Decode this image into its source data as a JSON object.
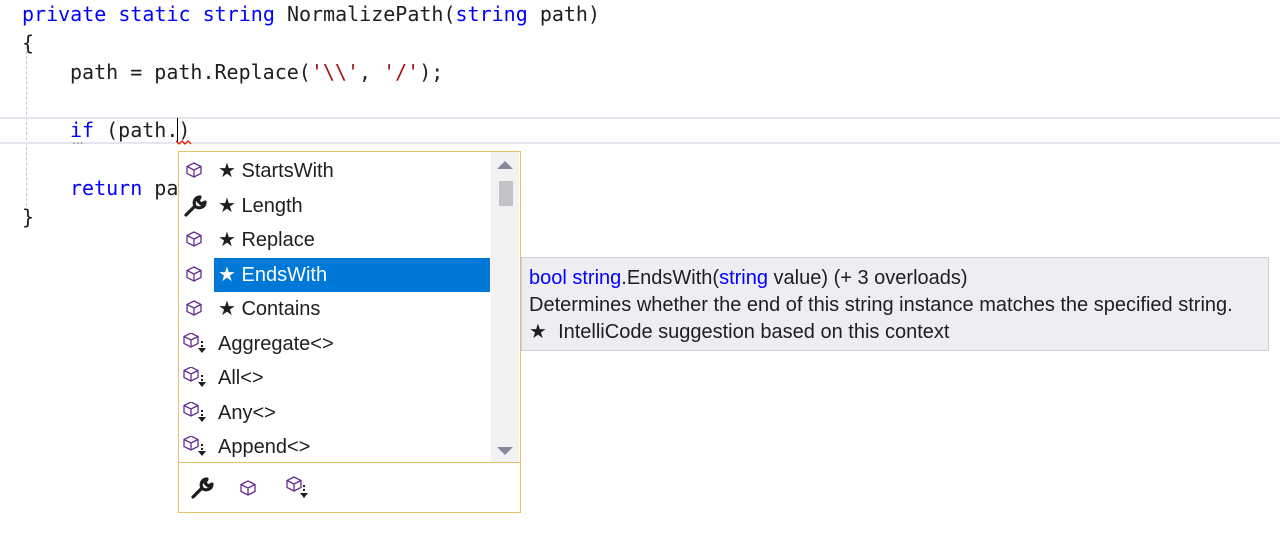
{
  "editor": {
    "line1": {
      "kw1": "private",
      "kw2": "static",
      "kw3": "string",
      "name": "NormalizePath(",
      "kw4": "string",
      "rest": "path)"
    },
    "line2": "{",
    "line3": {
      "a": "path = path.Replace(",
      "s1": "'\\\\'",
      "b": ", ",
      "s2": "'/'",
      "c": ");"
    },
    "line4": {
      "kw": "if",
      "rest": "(path.)"
    },
    "line5": {
      "kw": "return",
      "rest": "pa"
    },
    "line6": "}",
    "hint_dots": "..."
  },
  "completion": {
    "items": [
      {
        "label": "★ StartsWith",
        "icon": "method-icon",
        "selected": false
      },
      {
        "label": "★ Length",
        "icon": "property-wrench-icon",
        "selected": false
      },
      {
        "label": "★ Replace",
        "icon": "method-icon",
        "selected": false
      },
      {
        "label": "★ EndsWith",
        "icon": "method-icon",
        "selected": true
      },
      {
        "label": "★ Contains",
        "icon": "method-icon",
        "selected": false
      },
      {
        "label": "Aggregate<>",
        "icon": "extension-method-icon",
        "selected": false
      },
      {
        "label": "All<>",
        "icon": "extension-method-icon",
        "selected": false
      },
      {
        "label": "Any<>",
        "icon": "extension-method-icon",
        "selected": false
      },
      {
        "label": "Append<>",
        "icon": "extension-method-icon",
        "selected": false
      }
    ],
    "filters": [
      "property-filter-icon",
      "method-filter-icon",
      "extension-method-filter-icon"
    ],
    "selection_color": "#0078d7",
    "border_color": "#e5c365"
  },
  "tooltip": {
    "sig_type": "bool",
    "sig_class": "string",
    "sig_method": ".EndsWith(",
    "sig_param_type": "string",
    "sig_rest": " value) (+ 3 overloads)",
    "description": "Determines whether the end of this string instance matches the specified string.",
    "intellicode_star": "★",
    "intellicode": "IntelliCode suggestion based on this context"
  }
}
